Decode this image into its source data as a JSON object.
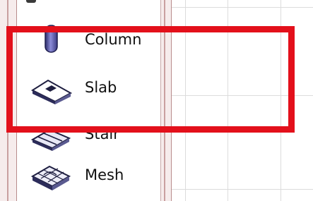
{
  "toolbox": {
    "items": [
      {
        "label": "Column",
        "icon": "column-icon"
      },
      {
        "label": "Slab",
        "icon": "slab-icon"
      },
      {
        "label": "Stair",
        "icon": "stair-icon"
      },
      {
        "label": "Mesh",
        "icon": "mesh-icon"
      }
    ]
  },
  "colors": {
    "highlight": "#e3101b",
    "frame": "#f6ecec",
    "grid": "#dcdcdc"
  }
}
